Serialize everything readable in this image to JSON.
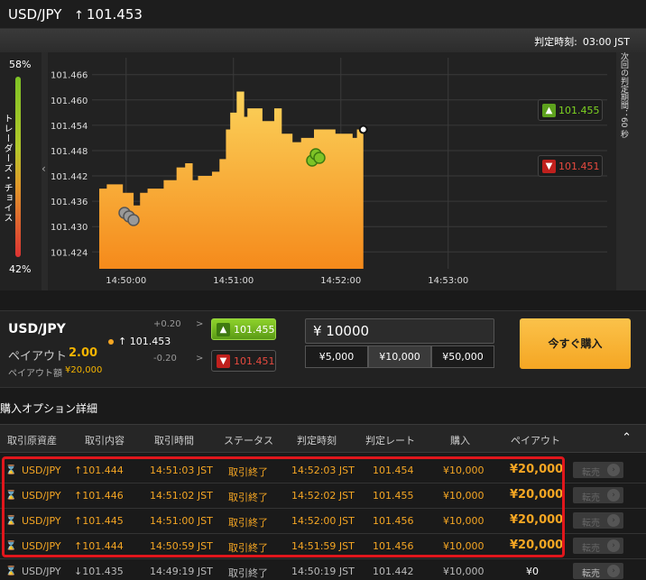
{
  "header": {
    "pair": "USD/JPY",
    "rate_arrow": "↑",
    "rate": "101.453"
  },
  "judge": {
    "label": "判定時刻:",
    "time": "03:00 JST"
  },
  "sentiment": {
    "top_pct": "58%",
    "bottom_pct": "42%",
    "label": "トレーダーズ・チョイス"
  },
  "chart": {
    "right_label": "次回の判定期間：60 秒",
    "high_button": {
      "value": "101.455"
    },
    "low_button": {
      "value": "101.451"
    }
  },
  "chart_data": {
    "type": "area",
    "yticks": [
      "101.466",
      "101.460",
      "101.454",
      "101.448",
      "101.442",
      "101.436",
      "101.430",
      "101.424"
    ],
    "xticks": [
      "14:50:00",
      "14:51:00",
      "14:52:00",
      "14:53:00"
    ],
    "ylim": [
      101.42,
      101.47
    ],
    "x_minutes": [
      0,
      0.07,
      0.12,
      0.18,
      0.22,
      0.32,
      0.38,
      0.45,
      0.52,
      0.6,
      0.72,
      0.8,
      0.87,
      0.92,
      0.95,
      1.0,
      1.05,
      1.12,
      1.18,
      1.22,
      1.28,
      1.35,
      1.38,
      1.46,
      1.52,
      1.6,
      1.63,
      1.7,
      1.8,
      1.88,
      1.92,
      2.0,
      2.08,
      2.16,
      2.2,
      2.36,
      2.4,
      2.46
    ],
    "prices": [
      101.439,
      101.44,
      101.44,
      101.44,
      101.438,
      101.435,
      101.438,
      101.439,
      101.439,
      101.441,
      101.444,
      101.445,
      101.441,
      101.442,
      101.442,
      101.442,
      101.443,
      101.446,
      101.453,
      101.457,
      101.462,
      101.456,
      101.458,
      101.458,
      101.455,
      101.455,
      101.458,
      101.452,
      101.45,
      101.451,
      101.451,
      101.453,
      101.453,
      101.453,
      101.452,
      101.451,
      101.453,
      101.453
    ]
  },
  "trade": {
    "pair": "USD/JPY",
    "payout_label": "ペイアウト",
    "payout_value": "2.00",
    "payout_amount_label": "ペイアウト額",
    "payout_amount_value": "¥20,000",
    "plus": "+0.20",
    "minus": "-0.20",
    "gt": ">",
    "rate_arrow": "↑",
    "rate": "101.453",
    "high_value": "101.455",
    "low_value": "101.451",
    "amount": "¥ 10000",
    "amount_options": [
      "¥5,000",
      "¥10,000",
      "¥50,000"
    ],
    "buy_now": "今すぐ購入"
  },
  "details": {
    "title": "購入オプション詳細",
    "headers": [
      "取引原資産",
      "取引内容",
      "取引時間",
      "ステータス",
      "判定時刻",
      "判定レート",
      "購入",
      "ペイアウト"
    ],
    "resell_label": "転売",
    "rows": [
      {
        "pair": "USD/JPY",
        "arrow": "↑",
        "content": "101.444",
        "time": "14:51:03 JST",
        "status": "取引終了",
        "judge": "14:52:03 JST",
        "jrate": "101.454",
        "buy": "¥10,000",
        "payout": "¥20,000"
      },
      {
        "pair": "USD/JPY",
        "arrow": "↑",
        "content": "101.446",
        "time": "14:51:02 JST",
        "status": "取引終了",
        "judge": "14:52:02 JST",
        "jrate": "101.455",
        "buy": "¥10,000",
        "payout": "¥20,000"
      },
      {
        "pair": "USD/JPY",
        "arrow": "↑",
        "content": "101.445",
        "time": "14:51:00 JST",
        "status": "取引終了",
        "judge": "14:52:00 JST",
        "jrate": "101.456",
        "buy": "¥10,000",
        "payout": "¥20,000"
      },
      {
        "pair": "USD/JPY",
        "arrow": "↑",
        "content": "101.444",
        "time": "14:50:59 JST",
        "status": "取引終了",
        "judge": "14:51:59 JST",
        "jrate": "101.456",
        "buy": "¥10,000",
        "payout": "¥20,000"
      },
      {
        "pair": "USD/JPY",
        "arrow": "↓",
        "content": "101.435",
        "time": "14:49:19 JST",
        "status": "取引終了",
        "judge": "14:50:19 JST",
        "jrate": "101.442",
        "buy": "¥10,000",
        "payout": "¥0"
      }
    ]
  }
}
